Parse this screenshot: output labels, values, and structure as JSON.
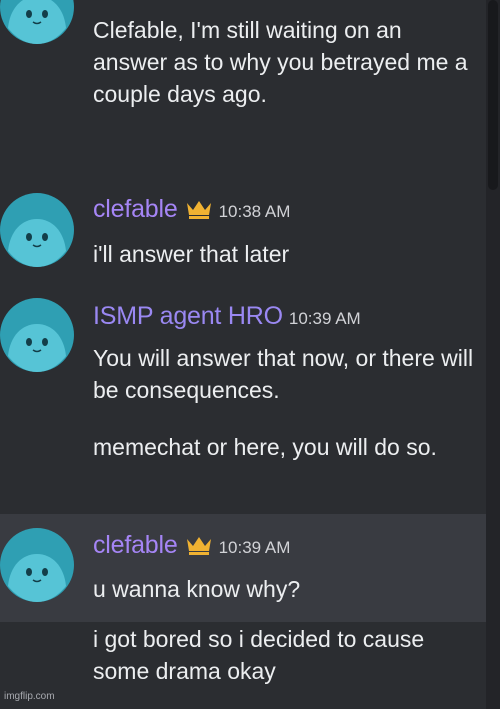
{
  "messages": [
    {
      "author": "",
      "timestamp": "",
      "lines": [
        "Clefable, I'm still waiting on an answer as to why you betrayed me a couple days ago."
      ]
    },
    {
      "author": "clefable",
      "author_color": "#a585f5",
      "has_crown": true,
      "crown_icon": "crown-icon",
      "timestamp": "10:38 AM",
      "lines": [
        "i'll answer that later"
      ]
    },
    {
      "author": "ISMP agent HRO",
      "author_color": "#9a88f2",
      "has_crown": false,
      "timestamp": "10:39 AM",
      "lines": [
        "You will answer that now, or there will be consequences.",
        "memechat or here, you will do so."
      ]
    },
    {
      "author": "clefable",
      "author_color": "#a585f5",
      "has_crown": true,
      "crown_icon": "crown-icon",
      "timestamp": "10:39 AM",
      "lines": [
        "u wanna know why?",
        "i got bored so i decided to cause some drama okay"
      ]
    }
  ],
  "colors": {
    "background": "#2b2d31",
    "hover_background": "#393b41",
    "crown": "#f0b232",
    "avatar": "#34b3c6"
  },
  "watermark": "imgflip.com"
}
